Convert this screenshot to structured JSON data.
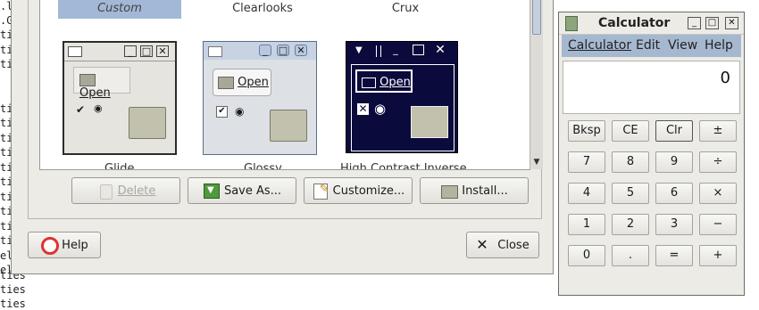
{
  "terminal": {
    "lines": [
      ".l",
      ".G",
      "ti",
      "ti",
      "ti",
      "ti",
      "ti",
      "ti",
      "ti",
      "ti",
      "ti",
      "ti",
      "ti",
      "ti",
      "ti",
      "ti",
      "ti",
      "el",
      "el",
      "ties",
      "ties",
      "ties"
    ]
  },
  "themes": {
    "names": [
      "Custom",
      "Clearlooks",
      "Crux"
    ],
    "selected": "Custom",
    "preview_open_label": "Open",
    "captions_partial": [
      "Glide",
      "Glossy",
      "High Contrast Inverse"
    ]
  },
  "buttons": {
    "delete": "Delete",
    "save_as": "Save As...",
    "customize": "Customize...",
    "install": "Install...",
    "help": "Help",
    "close": "Close"
  },
  "calculator": {
    "title": "Calculator",
    "menu": [
      "Calculator",
      "Edit",
      "View",
      "Help"
    ],
    "display": "0",
    "keys": [
      [
        "Bksp",
        "CE",
        "Clr",
        "±"
      ],
      [
        "7",
        "8",
        "9",
        "÷"
      ],
      [
        "4",
        "5",
        "6",
        "×"
      ],
      [
        "1",
        "2",
        "3",
        "−"
      ],
      [
        "0",
        ".",
        "=",
        "+"
      ]
    ]
  },
  "colors": {
    "selection": "#a3b8d6",
    "menubar": "#a6b8d0",
    "dialog_bg": "#ecebe6",
    "hc_bg": "#0b0a3c"
  }
}
